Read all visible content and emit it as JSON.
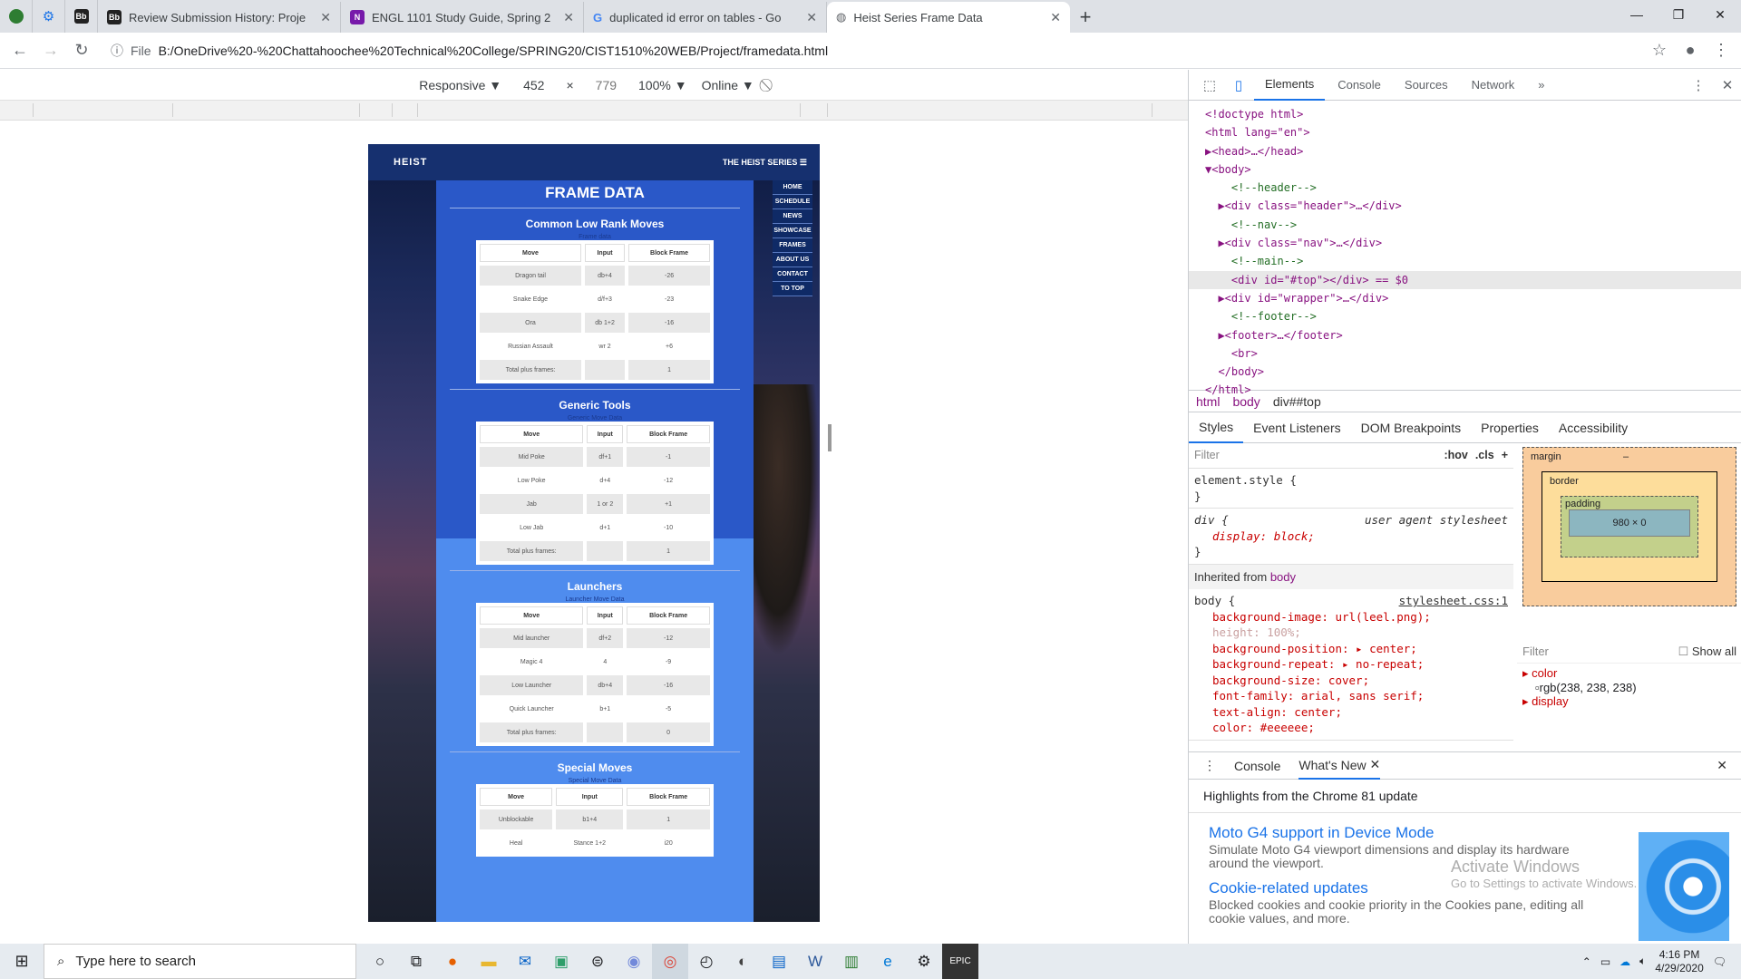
{
  "tabs": [
    {
      "label": "Review Submission History: Proje",
      "icon": "blackboard-icon"
    },
    {
      "label": "ENGL 1101 Study Guide, Spring 2",
      "icon": "onenote-icon"
    },
    {
      "label": "duplicated id error on tables - Go",
      "icon": "google-icon"
    },
    {
      "label": "Heist Series Frame Data",
      "icon": "globe-icon"
    }
  ],
  "address": {
    "scheme": "File",
    "url": "B:/OneDrive%20-%20Chattahoochee%20Technical%20College/SPRING20/CIST1510%20WEB/Project/framedata.html"
  },
  "device": {
    "mode": "Responsive",
    "width": "452",
    "height": "779",
    "zoom": "100%",
    "throttle": "Online"
  },
  "site": {
    "logo": "HEIST",
    "series": "THE HEIST SERIES ☰",
    "title": "FRAME DATA",
    "nav": [
      "HOME",
      "SCHEDULE",
      "NEWS",
      "SHOWCASE",
      "FRAMES",
      "ABOUT US",
      "CONTACT",
      "TO TOP"
    ],
    "sections": [
      {
        "title": "Common Low Rank Moves",
        "caption": "Frame data",
        "headers": [
          "Move",
          "Input",
          "Block Frame"
        ],
        "rows": [
          [
            "Dragon tail",
            "db+4",
            "-26"
          ],
          [
            "Snake Edge",
            "d/f+3",
            "-23"
          ],
          [
            "Ora",
            "db 1+2",
            "-16"
          ],
          [
            "Russian Assault",
            "wr 2",
            "+6"
          ],
          [
            "Total plus frames:",
            "",
            "1"
          ]
        ]
      },
      {
        "title": "Generic Tools",
        "caption": "Generic Move Data",
        "headers": [
          "Move",
          "Input",
          "Block Frame"
        ],
        "rows": [
          [
            "Mid Poke",
            "df+1",
            "-1"
          ],
          [
            "Low Poke",
            "d+4",
            "-12"
          ],
          [
            "Jab",
            "1 or 2",
            "+1"
          ],
          [
            "Low Jab",
            "d+1",
            "-10"
          ],
          [
            "Total plus frames:",
            "",
            "1"
          ]
        ]
      },
      {
        "title": "Launchers",
        "caption": "Launcher Move Data",
        "headers": [
          "Move",
          "Input",
          "Block Frame"
        ],
        "rows": [
          [
            "Mid launcher",
            "df+2",
            "-12"
          ],
          [
            "Magic 4",
            "4",
            "-9"
          ],
          [
            "Low Launcher",
            "db+4",
            "-16"
          ],
          [
            "Quick Launcher",
            "b+1",
            "-5"
          ],
          [
            "Total plus frames:",
            "",
            "0"
          ]
        ]
      },
      {
        "title": "Special Moves",
        "caption": "Special Move Data",
        "headers": [
          "Move",
          "Input",
          "Block Frame"
        ],
        "rows": [
          [
            "Unblockable",
            "b1+4",
            "1"
          ],
          [
            "Heal",
            "Stance 1+2",
            "i20"
          ]
        ]
      }
    ]
  },
  "devtools": {
    "tabs": [
      "Elements",
      "Console",
      "Sources",
      "Network"
    ],
    "dom": [
      "<!doctype html>",
      "<html lang=\"en\">",
      "▶<head>…</head>",
      "▼<body>",
      "    <!--header-->",
      "  ▶<div class=\"header\">…</div>",
      "    <!--nav-->",
      "  ▶<div class=\"nav\">…</div>",
      "    <!--main-->",
      "    <div id=\"#top\"></div> == $0",
      "  ▶<div id=\"wrapper\">…</div>",
      "    <!--footer-->",
      "  ▶<footer>…</footer>",
      "    <br>",
      "  </body>",
      "</html>"
    ],
    "breadcrumb": [
      "html",
      "body",
      "div##top"
    ],
    "subtabs": [
      "Styles",
      "Event Listeners",
      "DOM Breakpoints",
      "Properties",
      "Accessibility"
    ],
    "filter": "Filter",
    "hov": ":hov",
    "cls": ".cls",
    "element_style": "element.style {",
    "ua": "user agent stylesheet",
    "div_rule": "div {",
    "div_prop": "display: block;",
    "inherited": "Inherited from",
    "inherited_el": "body",
    "body_rule": "body {",
    "sheet": "stylesheet.css:1",
    "body_props": [
      "background-image: url(leel.png);",
      "height: 100%;",
      "background-position: ▸ center;",
      "background-repeat: ▸ no-repeat;",
      "background-size: cover;",
      "font-family: arial, sans serif;",
      "text-align: center;",
      "color: #eeeeee;"
    ],
    "box": {
      "margin": "margin",
      "border": "border",
      "padding": "padding",
      "content": "980 × 0",
      "dash": "–"
    },
    "computed_filter": "Filter",
    "show_all": "Show all",
    "computed": [
      {
        "prop": "color",
        "val": "rgb(238, 238, 238)"
      },
      {
        "prop": "display",
        "val": ""
      }
    ],
    "drawer_tabs": [
      "Console",
      "What's New"
    ],
    "highlights": "Highlights from the Chrome 81 update",
    "news": [
      {
        "title": "Moto G4 support in Device Mode",
        "body": "Simulate Moto G4 viewport dimensions and display its hardware around the viewport."
      },
      {
        "title": "Cookie-related updates",
        "body": "Blocked cookies and cookie priority in the Cookies pane, editing all cookie values, and more."
      }
    ]
  },
  "watermark": {
    "title": "Activate Windows",
    "sub": "Go to Settings to activate Windows."
  },
  "taskbar": {
    "search": "Type here to search",
    "time": "4:16 PM",
    "date": "4/29/2020"
  }
}
